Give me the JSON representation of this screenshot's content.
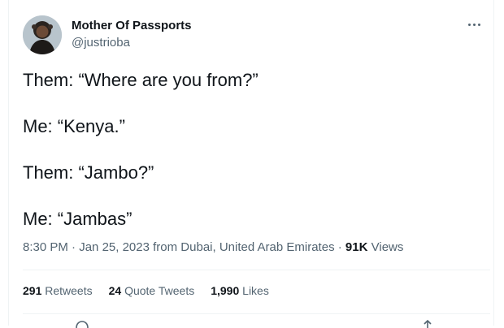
{
  "tweet": {
    "author_name": "Mother Of Passports",
    "author_handle": "@justrioba",
    "lines": [
      "Them: “Where are you from?”",
      "Me: “Kenya.”",
      "Them: “Jambo?”",
      "Me: “Jambas”"
    ],
    "time": "8:30 PM",
    "date": "Jan 25, 2023",
    "location": "from Dubai, United Arab Emirates",
    "views_count": "91K",
    "views_label": "Views",
    "separator": "·"
  },
  "stats": {
    "retweets_count": "291",
    "retweets_label": "Retweets",
    "quotes_count": "24",
    "quotes_label": "Quote Tweets",
    "likes_count": "1,990",
    "likes_label": "Likes"
  },
  "icons": {
    "more": "more-options-icon",
    "reply": "reply-icon",
    "share": "share-icon"
  },
  "colors": {
    "text_primary": "#0f1419",
    "text_secondary": "#536471",
    "divider": "#eff3f4"
  }
}
